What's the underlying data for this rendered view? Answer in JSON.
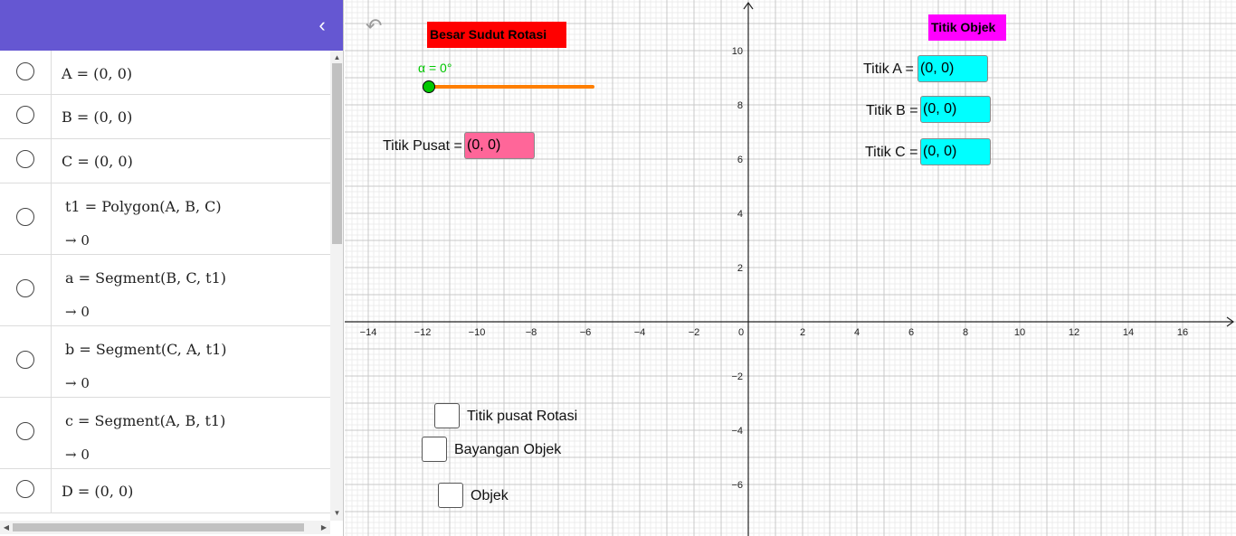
{
  "colors": {
    "header_bg": "#6557d2",
    "title_sudut_bg": "#ff0000",
    "title_objek_bg": "#ff00ff",
    "slider_track": "#ff7f00",
    "slider_point": "#00c800",
    "slider_label": "#00c800",
    "pusat_input_bg": "#ff6699",
    "objek_input_bg": "#00ffff"
  },
  "algebra": {
    "collapse_icon": "chevron-left-icon",
    "rows": [
      {
        "def": "A = (0, 0)"
      },
      {
        "def": "B = (0, 0)"
      },
      {
        "def": "C = (0, 0)"
      },
      {
        "def": "t1 = Polygon(A, B, C)",
        "val": "→ 0"
      },
      {
        "def": "a = Segment(B, C, t1)",
        "val": "→ 0"
      },
      {
        "def": "b = Segment(C, A, t1)",
        "val": "→ 0"
      },
      {
        "def": "c = Segment(A, B, t1)",
        "val": "→ 0"
      },
      {
        "def": "D = (0, 0)"
      }
    ]
  },
  "graphics": {
    "undo_icon": "undo-icon",
    "title_sudut": "Besar Sudut Rotasi",
    "title_objek": "Titik Objek",
    "slider": {
      "label": "α = 0°",
      "value": 0
    },
    "pusat": {
      "label": "Titik Pusat =",
      "value": "(0, 0)"
    },
    "objek_inputs": [
      {
        "label": "Titik A =",
        "value": "(0, 0)"
      },
      {
        "label": "Titik B =",
        "value": "(0, 0)"
      },
      {
        "label": "Titik C =",
        "value": "(0, 0)"
      }
    ],
    "checkboxes": [
      {
        "label": "Titik pusat Rotasi",
        "checked": false
      },
      {
        "label": "Bayangan Objek",
        "checked": false
      },
      {
        "label": "Objek",
        "checked": false
      }
    ],
    "axes": {
      "x_ticks": [
        "−14",
        "−12",
        "−10",
        "−8",
        "−6",
        "−4",
        "−2",
        "0",
        "2",
        "4",
        "6",
        "8",
        "10",
        "12",
        "14",
        "16"
      ],
      "y_ticks": [
        "10",
        "8",
        "6",
        "4",
        "2",
        "−2",
        "−4",
        "−6"
      ]
    }
  }
}
